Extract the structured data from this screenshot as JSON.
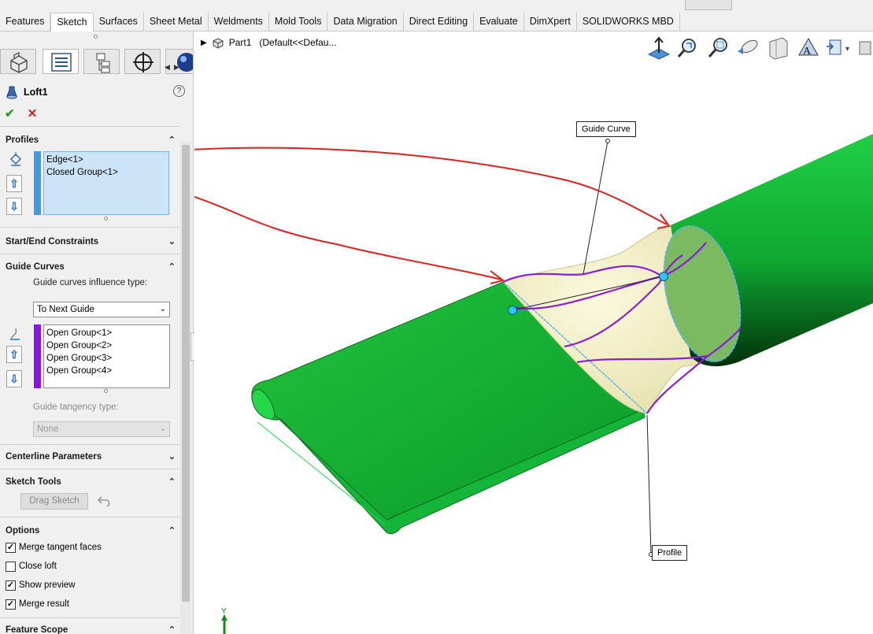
{
  "tabs": [
    "Features",
    "Sketch",
    "Surfaces",
    "Sheet Metal",
    "Weldments",
    "Mold Tools",
    "Data Migration",
    "Direct Editing",
    "Evaluate",
    "DimXpert",
    "SOLIDWORKS MBD"
  ],
  "active_tab": "Sketch",
  "panel": {
    "feature_title": "Loft1",
    "help_symbol": "?",
    "ok_symbol": "✔",
    "cancel_symbol": "✕",
    "profiles": {
      "header": "Profiles",
      "items": [
        "Edge<1>",
        "Closed Group<1>"
      ],
      "bar_color": "#3f98e8"
    },
    "start_end_constraints": {
      "header": "Start/End Constraints"
    },
    "guide_curves": {
      "header": "Guide Curves",
      "influence_label": "Guide curves influence type:",
      "influence_value": "To Next Guide",
      "items": [
        "Open Group<1>",
        "Open Group<2>",
        "Open Group<3>",
        "Open Group<4>"
      ],
      "bar_color": "#8a12ea",
      "tangency_label": "Guide tangency type:",
      "tangency_value": "None"
    },
    "centerline_parameters": {
      "header": "Centerline Parameters"
    },
    "sketch_tools": {
      "header": "Sketch Tools",
      "drag_sketch": "Drag Sketch"
    },
    "options": {
      "header": "Options",
      "items": [
        {
          "label": "Merge tangent faces",
          "checked": true
        },
        {
          "label": "Close loft",
          "checked": false
        },
        {
          "label": "Show preview",
          "checked": true
        },
        {
          "label": "Merge result",
          "checked": true
        }
      ]
    },
    "feature_scope": {
      "header": "Feature Scope"
    }
  },
  "viewport": {
    "tree_part": "Part1",
    "tree_config": "(Default<<Defau...",
    "callout_guide": "Guide Curve",
    "callout_profile": "Profile",
    "axis_label": "Y",
    "colors": {
      "solid_green": "#10b838",
      "loft_preview": "#f4f1c8",
      "guide_curve": "#8a1ed8",
      "annotation_red": "#e02020",
      "edge_highlight": "#59b5e8"
    }
  },
  "icons": [
    "part-icon",
    "property-manager-icon",
    "configuration-icon",
    "target-icon",
    "appearance-icon",
    "loft-icon",
    "profile-icon",
    "guide-curve-icon",
    "arrow-up-icon",
    "arrow-down-icon",
    "undo-icon"
  ]
}
